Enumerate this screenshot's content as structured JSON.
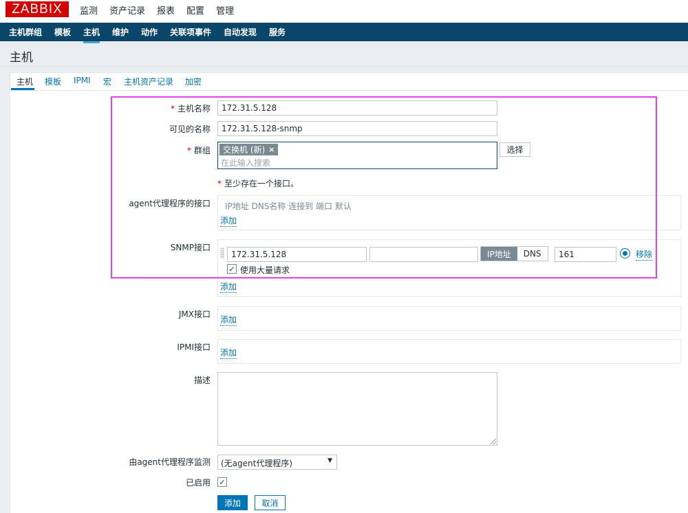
{
  "app": {
    "logo": "ZABBIX"
  },
  "top_menu": [
    "监测",
    "资产记录",
    "报表",
    "配置",
    "管理"
  ],
  "sub_menu": [
    "主机群组",
    "模板",
    "主机",
    "维护",
    "动作",
    "关联项事件",
    "自动发现",
    "服务"
  ],
  "page_title": "主机",
  "tabs": [
    "主机",
    "模板",
    "IPMI",
    "宏",
    "主机资产记录",
    "加密"
  ],
  "form": {
    "host_name_label": "主机名称",
    "host_name_value": "172.31.5.128",
    "visible_name_label": "可见的名称",
    "visible_name_value": "172.31.5.128-snmp",
    "groups_label": "群组",
    "group_chip": "交换机 (新)",
    "group_remove_icon": "×",
    "groups_placeholder": "在此输入搜索",
    "select_button": "选择",
    "required_marker": "*",
    "interface_note": "至少存在一个接口。",
    "agent_interfaces_label": "agent代理程序的接口",
    "interface_header": "IP地址  DNS名称  连接到  端口  默认",
    "add_link": "添加",
    "snmp_interfaces_label": "SNMP接口",
    "snmp_ip": "172.31.5.128",
    "snmp_dns": "",
    "connect_ip": "IP地址",
    "connect_dns": "DNS",
    "snmp_port": "161",
    "remove_link": "移除",
    "bulk_label": "使用大量请求",
    "bulk_checked": true,
    "jmx_label": "JMX接口",
    "ipmi_label": "IPMI接口",
    "description_label": "描述",
    "description_value": "",
    "monitored_by_label": "由agent代理程序监测",
    "monitored_by_value": "(无agent代理程序)",
    "enabled_label": "已启用",
    "enabled_checked": true,
    "add_button": "添加",
    "cancel_button": "取消"
  },
  "colors": {
    "brand": "#d40000",
    "nav": "#0a466a",
    "link": "#0275b8",
    "highlight": "#e040e6"
  }
}
